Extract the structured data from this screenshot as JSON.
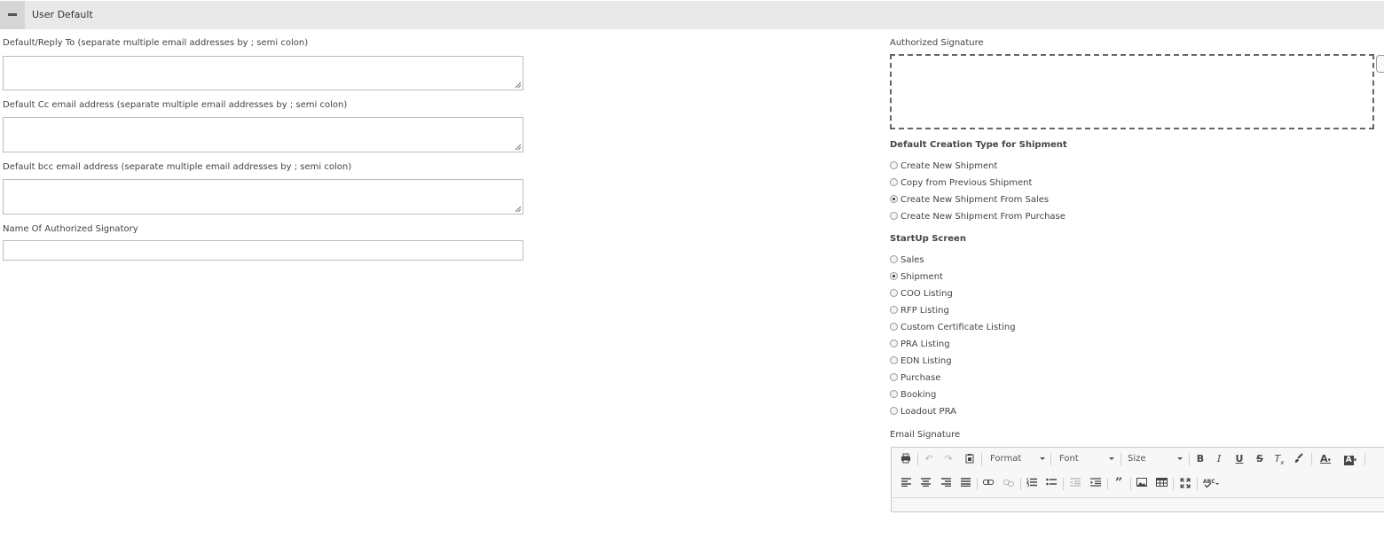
{
  "section": {
    "title": "User Default",
    "toggle_icon": "minus-icon"
  },
  "left": {
    "reply_to": {
      "label": "Default/Reply To (separate multiple email addresses by ; semi colon)",
      "value": ""
    },
    "cc": {
      "label": "Default Cc email address (separate multiple email addresses by ; semi colon)",
      "value": ""
    },
    "bcc": {
      "label": "Default bcc email address (separate multiple email addresses by ; semi colon)",
      "value": ""
    },
    "signatory": {
      "label": "Name Of Authorized Signatory",
      "value": ""
    }
  },
  "right": {
    "authorized_signature": {
      "label": "Authorized Signature"
    },
    "creation_type": {
      "label": "Default Creation Type for Shipment",
      "options": [
        "Create New Shipment",
        "Copy from Previous Shipment",
        "Create New Shipment From Sales",
        "Create New Shipment From Purchase"
      ],
      "selected": "Create New Shipment From Sales"
    },
    "startup": {
      "label": "StartUp Screen",
      "options": [
        "Sales",
        "Shipment",
        "COO Listing",
        "RFP Listing",
        "Custom Certificate Listing",
        "PRA Listing",
        "EDN Listing",
        "Purchase",
        "Booking",
        "Loadout PRA"
      ],
      "selected": "Shipment"
    },
    "email_signature": {
      "label": "Email Signature",
      "toolbar": {
        "format": "Format",
        "font": "Font",
        "size": "Size"
      }
    }
  }
}
